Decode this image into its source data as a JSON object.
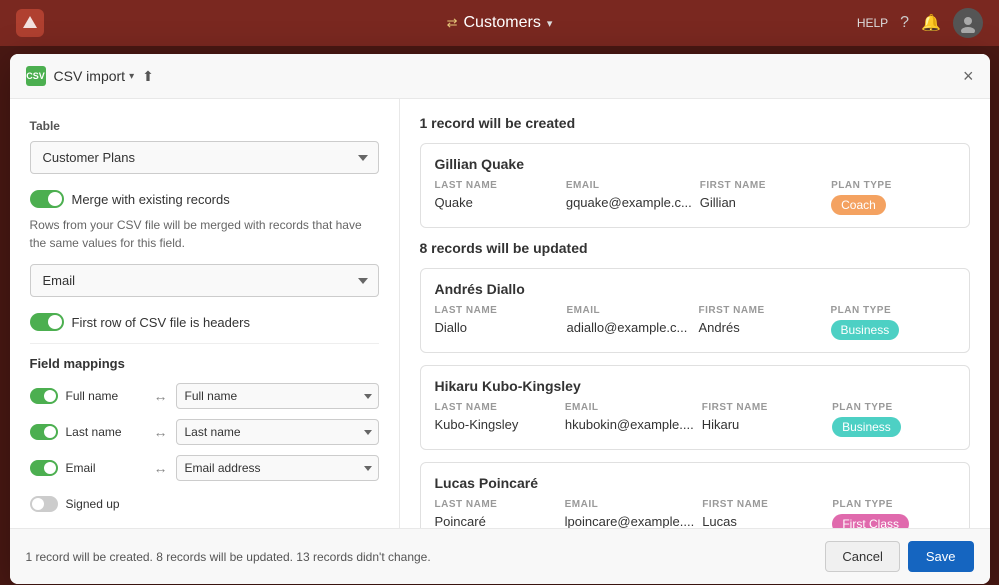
{
  "topbar": {
    "title": "Customers",
    "help_label": "HELP",
    "logo_letter": "T"
  },
  "modal": {
    "header": {
      "csv_label": "CSV",
      "import_label": "CSV import",
      "close_label": "×"
    },
    "left": {
      "table_label": "Table",
      "table_value": "Customer Plans",
      "merge_toggle_label": "Merge with existing records",
      "merge_description": "Rows from your CSV file will be merged with records that have the same values for this field.",
      "merge_field_value": "Email",
      "first_row_label": "First row of CSV file is headers",
      "field_mappings_label": "Field mappings",
      "mappings": [
        {
          "enabled": true,
          "source": "Full name",
          "target": "Full name"
        },
        {
          "enabled": true,
          "source": "Last name",
          "target": "Last name"
        },
        {
          "enabled": true,
          "source": "Email",
          "target": "Email address"
        },
        {
          "enabled": false,
          "source": "Signed up",
          "target": ""
        }
      ]
    },
    "right": {
      "created_section_title": "1 record will be created",
      "updated_section_title": "8 records will be updated",
      "created_records": [
        {
          "name": "Gillian Quake",
          "fields": {
            "last_name_header": "LAST NAME",
            "last_name": "Quake",
            "email_header": "EMAIL",
            "email": "gquake@example.c...",
            "first_name_header": "FIRST NAME",
            "first_name": "Gillian",
            "plan_type_header": "PLAN TYPE",
            "plan_type": "Coach",
            "plan_badge_class": "badge-coach"
          }
        }
      ],
      "updated_records": [
        {
          "name": "Andrés Diallo",
          "fields": {
            "last_name_header": "LAST NAME",
            "last_name": "Diallo",
            "email_header": "EMAIL",
            "email": "adiallo@example.c...",
            "first_name_header": "FIRST NAME",
            "first_name": "Andrés",
            "plan_type_header": "PLAN TYPE",
            "plan_type": "Business",
            "plan_badge_class": "badge-business"
          }
        },
        {
          "name": "Hikaru Kubo-Kingsley",
          "fields": {
            "last_name_header": "LAST NAME",
            "last_name": "Kubo-Kingsley",
            "email_header": "EMAIL",
            "email": "hkubokin@example....",
            "first_name_header": "FIRST NAME",
            "first_name": "Hikaru",
            "plan_type_header": "PLAN TYPE",
            "plan_type": "Business",
            "plan_badge_class": "badge-business"
          }
        },
        {
          "name": "Lucas Poincaré",
          "fields": {
            "last_name_header": "LAST NAME",
            "last_name": "Poincaré",
            "email_header": "EMAIL",
            "email": "lpoincare@example....",
            "first_name_header": "FIRST NAME",
            "first_name": "Lucas",
            "plan_type_header": "PLAN TYPE",
            "plan_type": "First Class",
            "plan_badge_class": "badge-firstclass"
          }
        }
      ]
    },
    "footer": {
      "status": "1 record will be created. 8 records will be updated. 13 records didn't change.",
      "cancel_label": "Cancel",
      "save_label": "Save"
    }
  }
}
